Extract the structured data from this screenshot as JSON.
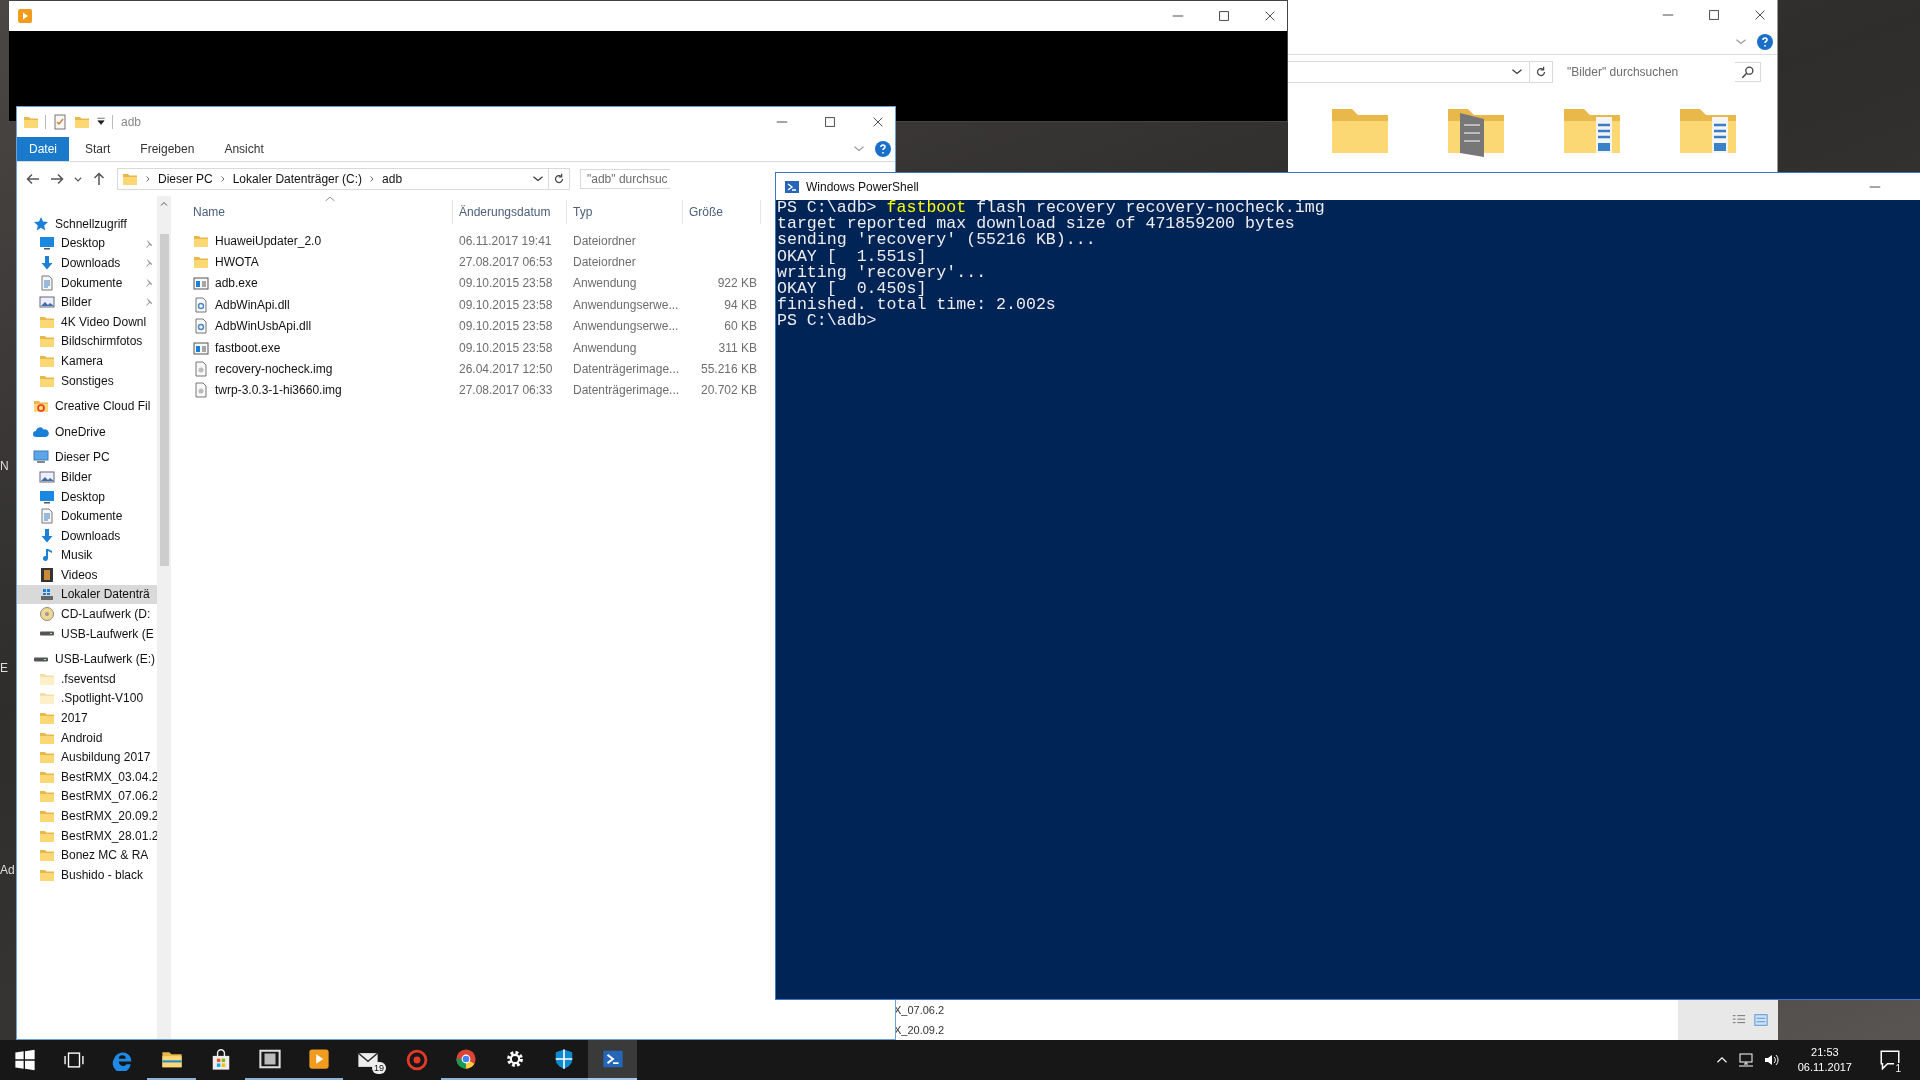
{
  "desktop_labels": [
    "N",
    "E",
    "Ad"
  ],
  "back_window": {
    "search": {
      "placeholder": "\"Bilder\" durchsuchen"
    },
    "folders": [
      {
        "kind": "plain"
      },
      {
        "kind": "document"
      },
      {
        "kind": "pictures"
      },
      {
        "kind": "pictures"
      }
    ],
    "nav_fragments": [
      "X_07.06.2",
      "X_20.09.2"
    ]
  },
  "explorer": {
    "title": "adb",
    "ribbon_tabs": [
      {
        "label": "Datei",
        "selected": true
      },
      {
        "label": "Start",
        "selected": false
      },
      {
        "label": "Freigeben",
        "selected": false
      },
      {
        "label": "Ansicht",
        "selected": false
      }
    ],
    "address": [
      "Dieser PC",
      "Lokaler Datenträger (C:)",
      "adb"
    ],
    "search": {
      "placeholder": "\"adb\" durchsuc"
    },
    "nav": [
      {
        "label": "Schnellzugriff",
        "kind": "star",
        "pinned": false,
        "selected": false,
        "children": [
          {
            "label": "Desktop",
            "kind": "desktop",
            "pinned": true,
            "selected": false
          },
          {
            "label": "Downloads",
            "kind": "download",
            "pinned": true,
            "selected": false
          },
          {
            "label": "Dokumente",
            "kind": "docs",
            "pinned": true,
            "selected": false
          },
          {
            "label": "Bilder",
            "kind": "pictures",
            "pinned": true,
            "selected": false
          },
          {
            "label": "4K Video Downl",
            "kind": "folder",
            "pinned": false,
            "selected": false
          },
          {
            "label": "Bildschirmfotos",
            "kind": "folder",
            "pinned": false,
            "selected": false
          },
          {
            "label": "Kamera",
            "kind": "folder",
            "pinned": false,
            "selected": false
          },
          {
            "label": "Sonstiges",
            "kind": "folder",
            "pinned": false,
            "selected": false
          }
        ]
      },
      {
        "label": "Creative Cloud Fil",
        "kind": "cc",
        "pinned": false,
        "selected": false
      },
      {
        "label": "OneDrive",
        "kind": "onedrive",
        "pinned": false,
        "selected": false
      },
      {
        "label": "Dieser PC",
        "kind": "pc",
        "pinned": false,
        "selected": false,
        "children": [
          {
            "label": "Bilder",
            "kind": "pictures",
            "pinned": false,
            "selected": false
          },
          {
            "label": "Desktop",
            "kind": "desktop",
            "pinned": false,
            "selected": false
          },
          {
            "label": "Dokumente",
            "kind": "docs",
            "pinned": false,
            "selected": false
          },
          {
            "label": "Downloads",
            "kind": "download",
            "pinned": false,
            "selected": false
          },
          {
            "label": "Musik",
            "kind": "music",
            "pinned": false,
            "selected": false
          },
          {
            "label": "Videos",
            "kind": "videos",
            "pinned": false,
            "selected": false
          },
          {
            "label": "Lokaler Datenträ",
            "kind": "drive",
            "pinned": false,
            "selected": true
          },
          {
            "label": "CD-Laufwerk (D:",
            "kind": "cd",
            "pinned": false,
            "selected": false
          },
          {
            "label": "USB-Laufwerk (E",
            "kind": "usb",
            "pinned": false,
            "selected": false
          }
        ]
      },
      {
        "label": "USB-Laufwerk (E:)",
        "kind": "usb",
        "pinned": false,
        "selected": false,
        "children": [
          {
            "label": ".fseventsd",
            "kind": "folder_faint",
            "pinned": false,
            "selected": false
          },
          {
            "label": ".Spotlight-V100",
            "kind": "folder_faint",
            "pinned": false,
            "selected": false
          },
          {
            "label": "2017",
            "kind": "folder",
            "pinned": false,
            "selected": false
          },
          {
            "label": "Android",
            "kind": "folder",
            "pinned": false,
            "selected": false
          },
          {
            "label": "Ausbildung 2017",
            "kind": "folder",
            "pinned": false,
            "selected": false
          },
          {
            "label": "BestRMX_03.04.2",
            "kind": "folder",
            "pinned": false,
            "selected": false
          },
          {
            "label": "BestRMX_07.06.2",
            "kind": "folder",
            "pinned": false,
            "selected": false
          },
          {
            "label": "BestRMX_20.09.2",
            "kind": "folder",
            "pinned": false,
            "selected": false
          },
          {
            "label": "BestRMX_28.01.2",
            "kind": "folder",
            "pinned": false,
            "selected": false
          },
          {
            "label": "Bonez MC & RA",
            "kind": "folder",
            "pinned": false,
            "selected": false
          },
          {
            "label": "Bushido - black",
            "kind": "folder",
            "pinned": false,
            "selected": false
          }
        ]
      }
    ],
    "columns": [
      "Name",
      "Änderungsdatum",
      "Typ",
      "Größe"
    ],
    "rows": [
      {
        "kind": "folder",
        "name": "HuaweiUpdater_2.0",
        "date": "06.11.2017 19:41",
        "type": "Dateiordner"
      },
      {
        "kind": "folder",
        "name": "HWOTA",
        "date": "27.08.2017 06:53",
        "type": "Dateiordner"
      },
      {
        "kind": "exe",
        "name": "adb.exe",
        "date": "09.10.2015 23:58",
        "type": "Anwendung",
        "size": "922 KB"
      },
      {
        "kind": "dll",
        "name": "AdbWinApi.dll",
        "date": "09.10.2015 23:58",
        "type": "Anwendungserwe...",
        "size": "94 KB"
      },
      {
        "kind": "dll",
        "name": "AdbWinUsbApi.dll",
        "date": "09.10.2015 23:58",
        "type": "Anwendungserwe...",
        "size": "60 KB"
      },
      {
        "kind": "exe",
        "name": "fastboot.exe",
        "date": "09.10.2015 23:58",
        "type": "Anwendung",
        "size": "311 KB"
      },
      {
        "kind": "img",
        "name": "recovery-nocheck.img",
        "date": "26.04.2017 12:50",
        "type": "Datenträgerimage...",
        "size": "55.216 KB"
      },
      {
        "kind": "img",
        "name": "twrp-3.0.3-1-hi3660.img",
        "date": "27.08.2017 06:33",
        "type": "Datenträgerimage...",
        "size": "20.702 KB"
      }
    ]
  },
  "powershell": {
    "title": "Windows PowerShell",
    "lines": [
      {
        "kind": "command",
        "prompt": "PS C:\\adb> ",
        "command": "fastboot",
        "rest": " flash recovery recovery-nocheck.img"
      },
      {
        "kind": "output",
        "text": "target reported max download size of 471859200 bytes"
      },
      {
        "kind": "output",
        "text": "sending 'recovery' (55216 KB)..."
      },
      {
        "kind": "output",
        "text": "OKAY [  1.551s]"
      },
      {
        "kind": "output",
        "text": "writing 'recovery'..."
      },
      {
        "kind": "output",
        "text": "OKAY [  0.450s]"
      },
      {
        "kind": "output",
        "text": "finished. total time: 2.002s"
      },
      {
        "kind": "output",
        "text": "PS C:\\adb>"
      }
    ]
  },
  "taskbar": {
    "apps": [
      {
        "kind": "windows",
        "open": false,
        "active": false
      },
      {
        "kind": "taskview",
        "open": false,
        "active": false
      },
      {
        "kind": "edge",
        "open": false,
        "active": false
      },
      {
        "kind": "folder",
        "open": true,
        "active": false
      },
      {
        "kind": "store",
        "open": false,
        "active": false
      },
      {
        "kind": "film",
        "open": true,
        "active": false
      },
      {
        "kind": "player",
        "open": true,
        "active": false
      },
      {
        "kind": "mail",
        "open": false,
        "active": false,
        "badge": "19"
      },
      {
        "kind": "target",
        "open": false,
        "active": false
      },
      {
        "kind": "chrome",
        "open": true,
        "active": false
      },
      {
        "kind": "gear",
        "open": true,
        "active": false
      },
      {
        "kind": "shield",
        "open": true,
        "active": false
      },
      {
        "kind": "terminal",
        "open": true,
        "active": true
      }
    ],
    "time": "21:53",
    "date": "06.11.2017",
    "notifications": "1"
  }
}
